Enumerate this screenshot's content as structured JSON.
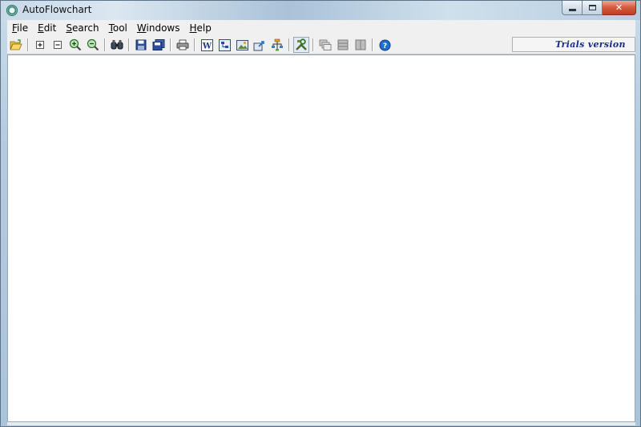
{
  "window": {
    "title": "AutoFlowchart",
    "controls": {
      "minimize": "minimize",
      "maximize": "maximize",
      "close": "✕"
    }
  },
  "menu": {
    "items": [
      {
        "accel": "F",
        "rest": "ile"
      },
      {
        "accel": "E",
        "rest": "dit"
      },
      {
        "accel": "S",
        "rest": "earch"
      },
      {
        "accel": "T",
        "rest": "ool"
      },
      {
        "accel": "W",
        "rest": "indows"
      },
      {
        "accel": "H",
        "rest": "elp"
      }
    ]
  },
  "toolbar": {
    "trial_label": "Trials version",
    "groups": [
      [
        "open-folder-icon"
      ],
      [
        "expand-icon",
        "collapse-icon",
        "zoom-in-icon",
        "zoom-out-icon"
      ],
      [
        "find-icon"
      ],
      [
        "save-icon",
        "save-all-icon"
      ],
      [
        "print-icon"
      ],
      [
        "word-export-icon",
        "visio-export-icon",
        "image-export-icon",
        "export-icon",
        "flowchart-icon"
      ],
      [
        "tools-icon"
      ],
      [
        "cascade-windows-icon",
        "tile-windows-icon",
        "arrange-windows-icon"
      ],
      [
        "help-icon"
      ]
    ]
  },
  "colors": {
    "accent": "#1b2a8a",
    "close_button": "#c23c22",
    "workspace": "#ffffff"
  }
}
